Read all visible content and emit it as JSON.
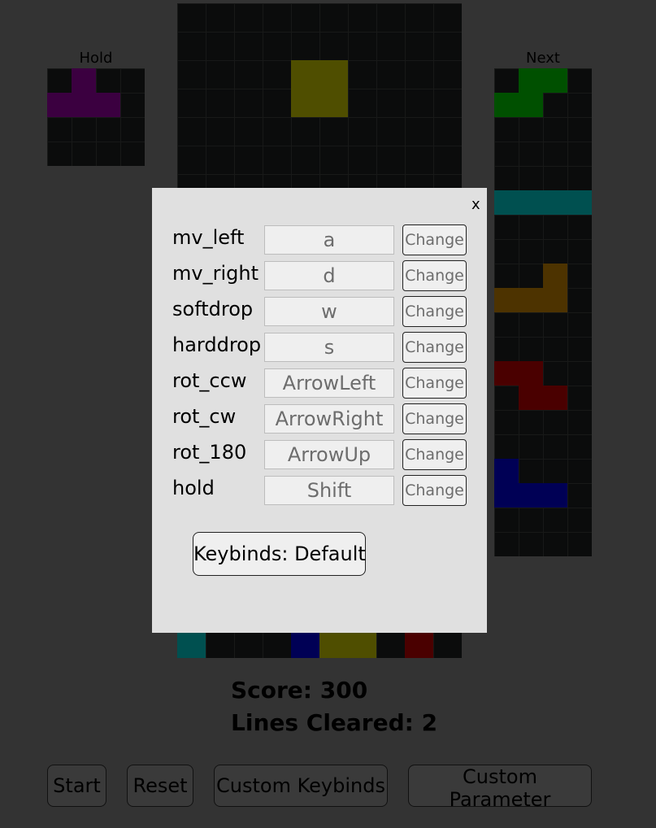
{
  "hold": {
    "label": "Hold"
  },
  "next": {
    "label": "Next"
  },
  "stats": {
    "score": "Score: 300",
    "lines": "Lines Cleared: 2"
  },
  "buttons": {
    "start": "Start",
    "reset": "Reset",
    "custom_keybinds": "Custom Keybinds",
    "custom_parameter": "Custom Parameter"
  },
  "modal": {
    "close": "x",
    "change_label": "Change",
    "keybinds": [
      {
        "action": "mv_left",
        "key": "a"
      },
      {
        "action": "mv_right",
        "key": "d"
      },
      {
        "action": "softdrop",
        "key": "w"
      },
      {
        "action": "harddrop",
        "key": "s"
      },
      {
        "action": "rot_ccw",
        "key": "ArrowLeft"
      },
      {
        "action": "rot_cw",
        "key": "ArrowRight"
      },
      {
        "action": "rot_180",
        "key": "ArrowUp"
      },
      {
        "action": "hold",
        "key": "Shift"
      }
    ],
    "preset_button": "Keybinds: Default"
  },
  "colors": {
    "page_background": "#333333",
    "grid_background": "#0b0c0c",
    "piece_t": "#3b0040",
    "piece_o": "#4f4e00",
    "piece_s": "#005000",
    "piece_i": "#005050",
    "piece_l": "#4d3300",
    "piece_z": "#4a0000",
    "piece_j": "#000055",
    "modal_background": "#e0e0e0"
  }
}
